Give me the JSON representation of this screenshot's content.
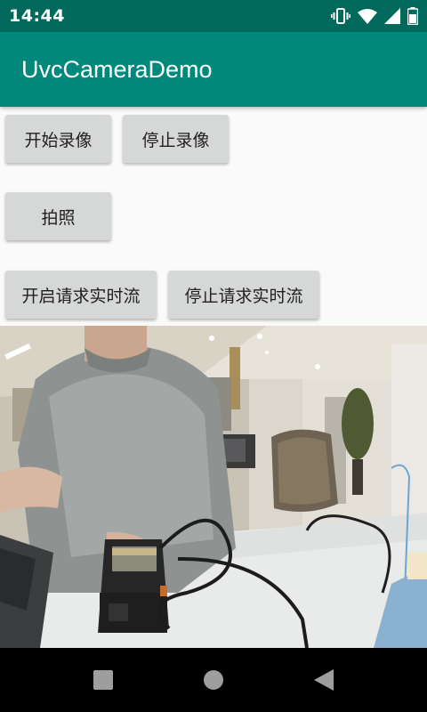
{
  "status_bar": {
    "time": "14:44",
    "icons": [
      "vibrate-icon",
      "wifi-icon",
      "signal-icon",
      "battery-icon"
    ]
  },
  "app_bar": {
    "title": "UvcCameraDemo",
    "color": "#00897b",
    "status_color": "#00695c"
  },
  "buttons": {
    "start_record": "开始录像",
    "stop_record": "停止录像",
    "take_photo": "拍照",
    "start_stream": "开启请求实时流",
    "stop_stream": "停止请求实时流"
  },
  "preview": {
    "icon": "camera-preview"
  },
  "nav_bar": {
    "icons": [
      "recents-square-icon",
      "home-circle-icon",
      "back-triangle-icon"
    ]
  }
}
